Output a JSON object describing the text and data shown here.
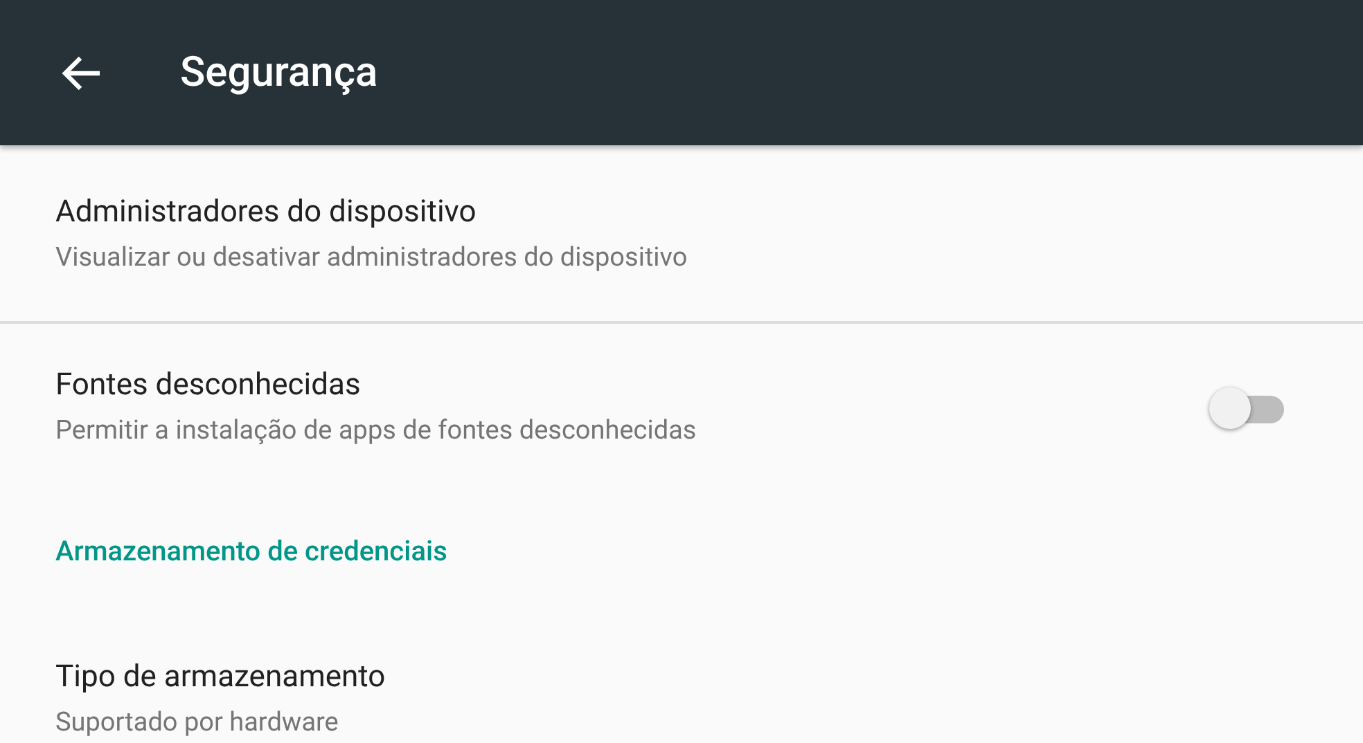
{
  "app_bar": {
    "title": "Segurança"
  },
  "items": [
    {
      "kind": "item",
      "title": "Administradores do dispositivo",
      "subtitle": "Visualizar ou desativar administradores do dispositivo",
      "divider": true
    },
    {
      "kind": "toggle",
      "title": "Fontes desconhecidas",
      "subtitle": "Permitir a instalação de apps de fontes desconhecidas",
      "on": false
    },
    {
      "kind": "header",
      "title": "Armazenamento de credenciais"
    },
    {
      "kind": "item",
      "title": "Tipo de armazenamento",
      "subtitle": "Suportado por hardware"
    }
  ]
}
